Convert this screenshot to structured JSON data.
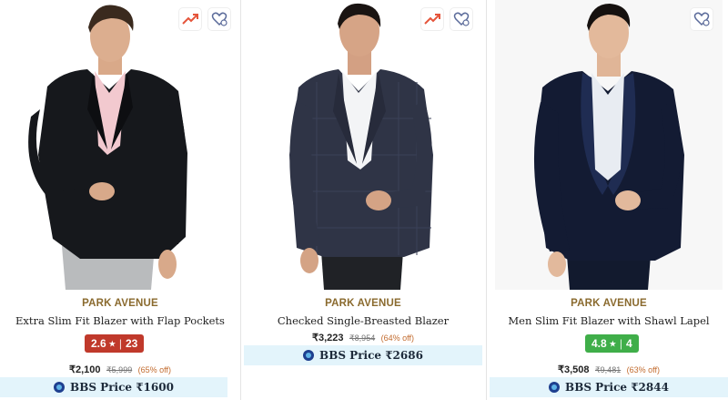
{
  "products": [
    {
      "brand": "PARK AVENUE",
      "title": "Extra Slim Fit Blazer with Flap Pockets",
      "rating": "2.6",
      "rating_count": "23",
      "rating_color": "#c0392b",
      "price": "₹2,100",
      "mrp": "₹5,999",
      "discount": "(65% off)",
      "bbs_price": "BBS Price ₹1600",
      "icons": [
        "trending-icon",
        "wishlist-icon"
      ]
    },
    {
      "brand": "PARK AVENUE",
      "title": "Checked Single-Breasted Blazer",
      "price": "₹3,223",
      "mrp": "₹8,954",
      "discount": "(64% off)",
      "bbs_price": "BBS Price ₹2686",
      "icons": [
        "trending-icon",
        "wishlist-icon"
      ]
    },
    {
      "brand": "PARK AVENUE",
      "title": "Men Slim Fit Blazer with Shawl Lapel",
      "rating": "4.8",
      "rating_count": "4",
      "rating_color": "#3fae49",
      "price": "₹3,508",
      "mrp": "₹9,481",
      "discount": "(63% off)",
      "bbs_price": "BBS Price ₹2844",
      "icons": [
        "wishlist-icon"
      ]
    }
  ],
  "colors": {
    "brand_text": "#8a6a2e",
    "bbs_background": "#e3f4fb",
    "trend_icon": "#e5553b",
    "wishlist_icon": "#5b6b9a"
  }
}
